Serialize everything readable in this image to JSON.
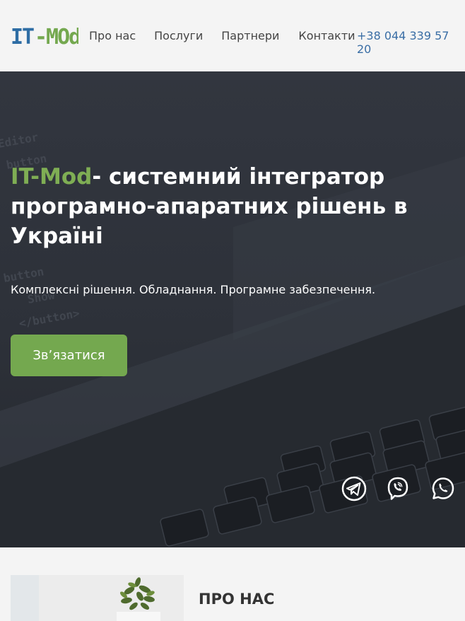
{
  "brand": {
    "logo_text": "IT-MOd",
    "name": "IT-Mod"
  },
  "nav": {
    "items": [
      {
        "label": "Про нас"
      },
      {
        "label": "Послуги"
      },
      {
        "label": "Партнери"
      },
      {
        "label": "Контакти"
      }
    ],
    "phone": "+38 044 339 57 20"
  },
  "hero": {
    "title_brand": "IT-Mod",
    "title_rest": "- системний інтегратор програмно-апаратних рішень в Україні",
    "subtitle": "Комплексні рішення. Обладнання. Програмне забезпечення.",
    "cta_label": "Зв’язатися",
    "background_code": [
      "Editor",
      "button",
      "button",
      "Show",
      "</button>"
    ]
  },
  "social": [
    {
      "icon": "telegram-icon"
    },
    {
      "icon": "viber-icon"
    },
    {
      "icon": "whatsapp-icon"
    }
  ],
  "about": {
    "title": "ПРО НАС"
  },
  "colors": {
    "accent": "#74a84f",
    "brand_blue": "#2e6da4",
    "phone": "#3a6ea5",
    "hero_bg": "#2e323a"
  }
}
